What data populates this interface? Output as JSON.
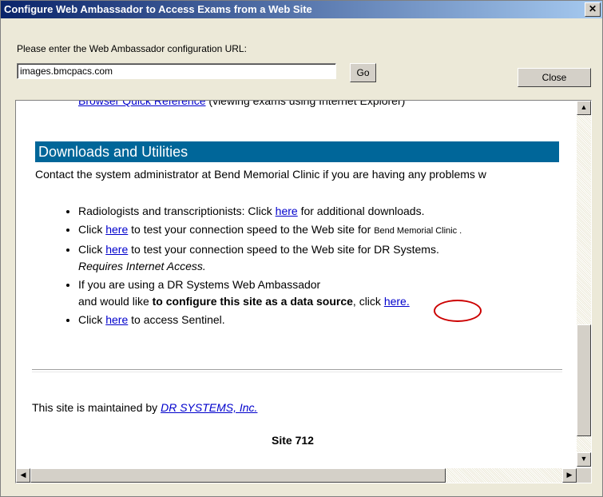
{
  "window": {
    "title": "Configure Web Ambassador to Access Exams from a Web Site",
    "close_glyph": "✕"
  },
  "config": {
    "prompt": "Please enter the Web Ambassador configuration URL:",
    "url_value": "images.bmcpacs.com",
    "go_label": "Go",
    "close_label": "Close"
  },
  "page": {
    "prev_link": "Browser Quick Reference",
    "prev_text": " (viewing exams using Internet Explorer)",
    "section_title": "Downloads and Utilities",
    "contact_text": "Contact the system administrator at Bend Memorial Clinic if you are having any problems w",
    "bullets": [
      {
        "pre": "Radiologists and transcriptionists: Click ",
        "link": "here",
        "post": " for additional downloads."
      },
      {
        "pre": "Click ",
        "link": "here",
        "post": " to test your connection speed to the Web site for ",
        "small": "Bend Memorial Clinic ."
      },
      {
        "pre": "Click ",
        "link": "here",
        "post": " to test your connection speed to the Web site for DR Systems.",
        "italic": "Requires Internet Access."
      },
      {
        "pre": "If you are using a DR Systems Web Ambassador",
        "line2_pre": "and would like ",
        "bold": "to configure this site as a data source",
        "line2_mid": ", click ",
        "link": "here."
      },
      {
        "pre": "Click ",
        "link": "here",
        "post": " to access Sentinel."
      }
    ],
    "maintained_pre": "This site is maintained by ",
    "maintained_link": "DR SYSTEMS, Inc.",
    "site_label": "Site 712"
  },
  "scrollbars": {
    "up_glyph": "▲",
    "down_glyph": "▼",
    "left_glyph": "◀",
    "right_glyph": "▶"
  },
  "colors": {
    "section_header_bg": "#006699",
    "link": "#0000cc",
    "highlight_circle": "#cc0000"
  }
}
